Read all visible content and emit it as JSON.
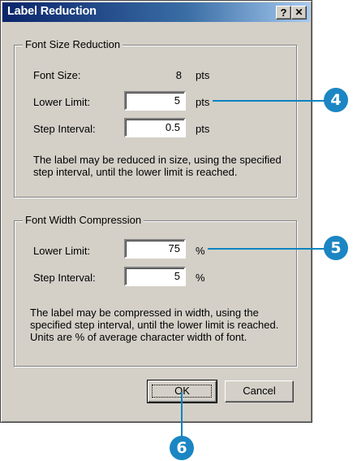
{
  "window": {
    "title": "Label Reduction",
    "help_label": "?",
    "close_label": "✕"
  },
  "font_size_group": {
    "legend": "Font Size Reduction",
    "font_size_label": "Font Size:",
    "font_size_value": "8",
    "font_size_unit": "pts",
    "lower_limit_label": "Lower Limit:",
    "lower_limit_value": "5",
    "lower_limit_unit": "pts",
    "step_interval_label": "Step Interval:",
    "step_interval_value": "0.5",
    "step_interval_unit": "pts",
    "description_line1": "The label may be reduced in size, using the specified",
    "description_line2": "step interval, until the lower limit is reached."
  },
  "font_width_group": {
    "legend": "Font Width Compression",
    "lower_limit_label": "Lower Limit:",
    "lower_limit_value": "75",
    "lower_limit_unit": "%",
    "step_interval_label": "Step Interval:",
    "step_interval_value": "5",
    "step_interval_unit": "%",
    "description_line1": "The label may be compressed in width, using the",
    "description_line2": "specified step interval, until the lower limit is reached.",
    "description_line3": "Units are % of average character width of font."
  },
  "buttons": {
    "ok_label": "OK",
    "cancel_label": "Cancel"
  },
  "callouts": {
    "callout_4": "4",
    "callout_5": "5",
    "callout_6": "6"
  },
  "colors": {
    "dialog_bg": "#d4d0c8",
    "titlebar_start": "#0a246a",
    "titlebar_end": "#a6caf0",
    "callout": "#1b86c3"
  }
}
